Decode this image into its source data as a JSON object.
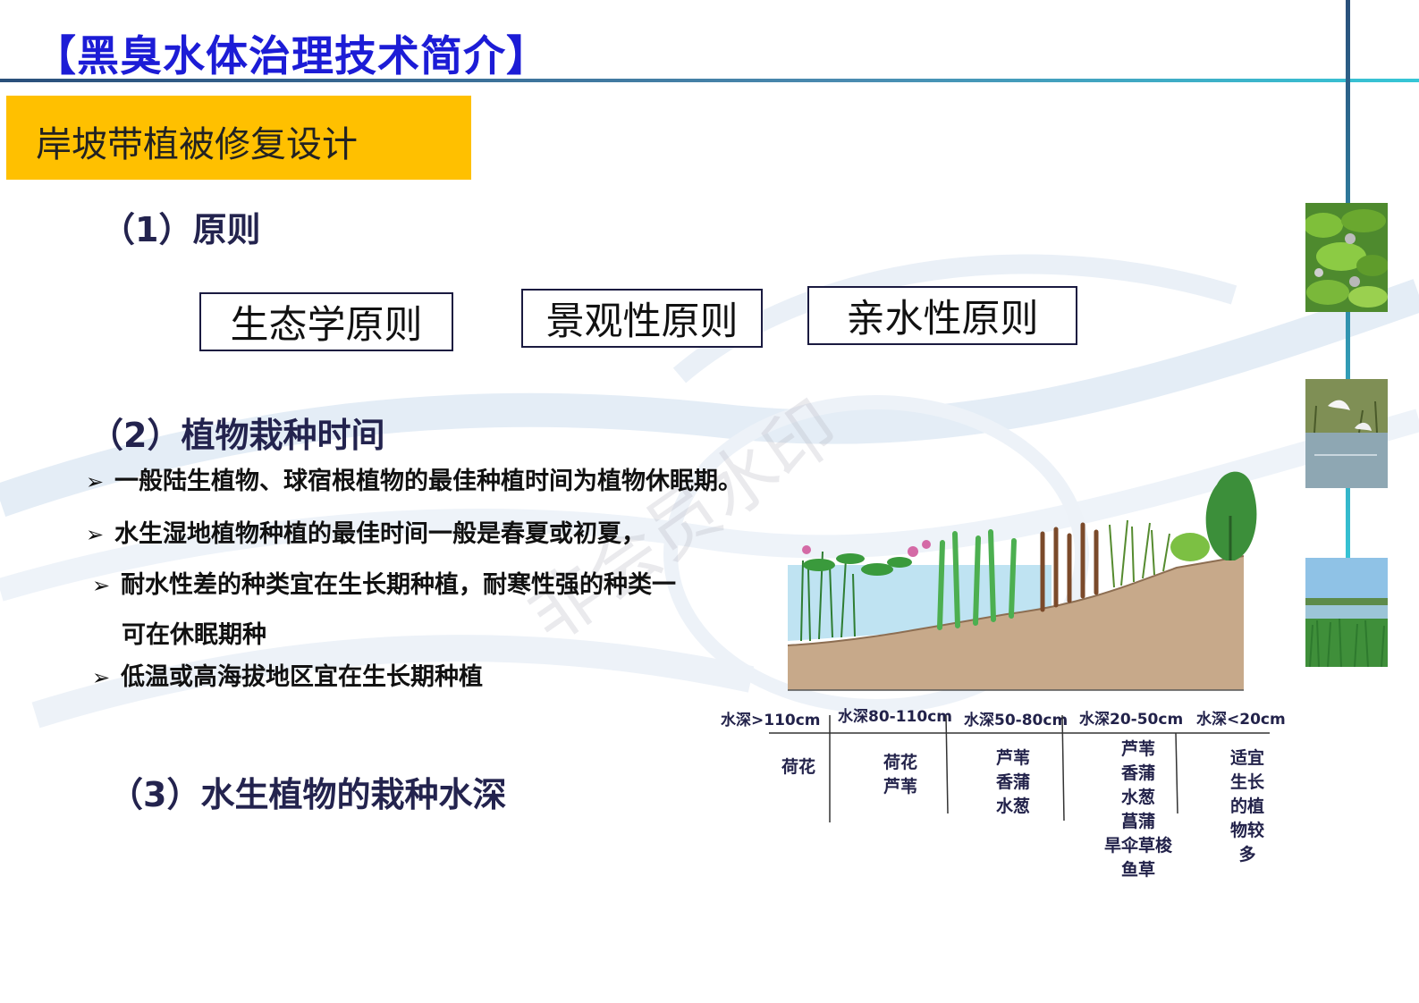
{
  "header": {
    "title": "【黑臭水体治理技术简介】",
    "section": "岸坡带植被修复设计"
  },
  "principles": {
    "heading": "（1）原则",
    "items": [
      "生态学原则",
      "景观性原则",
      "亲水性原则"
    ]
  },
  "planting_time": {
    "heading": "（2）植物栽种时间",
    "bullet_1": "一般陆生植物、球宿根植物的最佳种植时间为植物休眠期。",
    "bullet_2": "水生湿地植物种植的最佳时间一般是春夏或初夏，",
    "bullet_3": "耐水性差的种类宜在生长期种植，耐寒性强的种类一",
    "bullet_3_cont": "可在休眠期种",
    "bullet_4": "低温或高海拔地区宜在生长期种植"
  },
  "planting_depth": {
    "heading": "（3）水生植物的栽种水深",
    "zones": [
      {
        "depth": "水深>110cm",
        "plants": [
          "荷花"
        ]
      },
      {
        "depth": "水深80-110cm",
        "plants": [
          "荷花",
          "芦苇"
        ]
      },
      {
        "depth": "水深50-80cm",
        "plants": [
          "芦苇",
          "香蒲",
          "水葱"
        ]
      },
      {
        "depth": "水深20-50cm",
        "plants": [
          "芦苇",
          "香蒲",
          "水葱",
          "菖蒲",
          "旱伞草梭",
          "鱼草"
        ]
      },
      {
        "depth": "水深<20cm",
        "plants": [
          "适宜",
          "生长",
          "的植",
          "物较",
          "多"
        ]
      }
    ]
  },
  "watermark": "非会员水印",
  "colors": {
    "title": "#1c1cd6",
    "banner": "#ffc000",
    "heading": "#23234e",
    "rule_start": "#2a4f7a",
    "rule_end": "#36c6d6"
  }
}
